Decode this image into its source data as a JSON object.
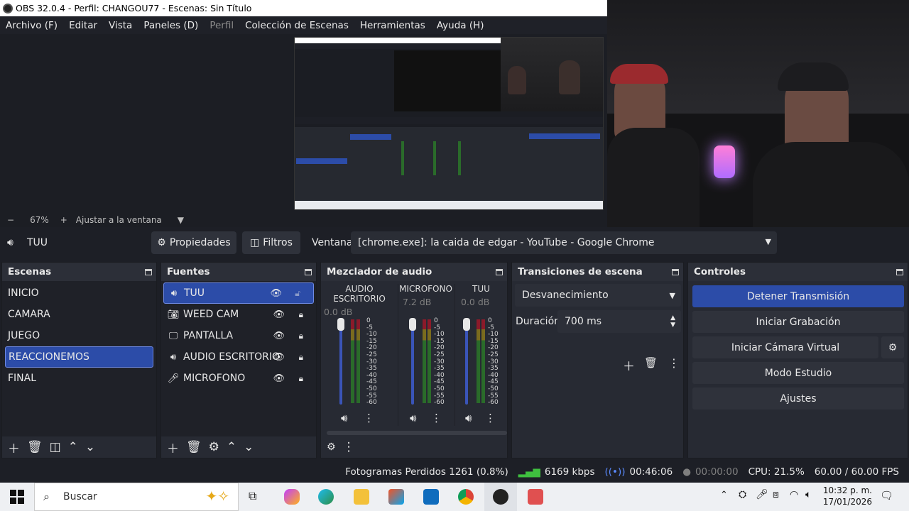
{
  "window": {
    "title": "OBS 32.0.4 - Perfil: CHANGOU77 - Escenas: Sin Título"
  },
  "menu": [
    "Archivo (F)",
    "Editar",
    "Vista",
    "Paneles (D)",
    "Perfil",
    "Colección de Escenas",
    "Herramientas",
    "Ayuda (H)"
  ],
  "zoom": {
    "minus": "−",
    "value": "67%",
    "plus": "+",
    "fit_label": "Ajustar a la ventana"
  },
  "source_toolbar": {
    "source_name": "TUU",
    "properties_label": "Propiedades",
    "filters_label": "Filtros",
    "window_label": "Ventana",
    "window_value": "[chrome.exe]: la caida de edgar - YouTube - Google Chrome"
  },
  "scenes": {
    "title": "Escenas",
    "items": [
      "INICIO",
      "CAMARA",
      "JUEGO",
      "REACCIONEMOS",
      "FINAL"
    ],
    "selected": "REACCIONEMOS"
  },
  "sources": {
    "title": "Fuentes",
    "items": [
      {
        "name": "TUU",
        "icon": "speaker-icon"
      },
      {
        "name": "WEED CAM",
        "icon": "camera-icon"
      },
      {
        "name": "PANTALLA",
        "icon": "monitor-icon"
      },
      {
        "name": "AUDIO ESCRITORIO",
        "icon": "speaker-icon"
      },
      {
        "name": "MICROFONO",
        "icon": "microphone-icon"
      }
    ],
    "selected": "TUU"
  },
  "mixer": {
    "title": "Mezclador de audio",
    "channels": [
      {
        "name": "AUDIO ESCRITORIO",
        "db": "0.0 dB"
      },
      {
        "name": "MICROFONO",
        "db": "7.2 dB"
      },
      {
        "name": "TUU",
        "db": "0.0 dB"
      }
    ],
    "scale": [
      "0",
      "-5",
      "-10",
      "-15",
      "-20",
      "-25",
      "-30",
      "-35",
      "-40",
      "-45",
      "-50",
      "-55",
      "-60"
    ]
  },
  "transitions": {
    "title": "Transiciones de escena",
    "type": "Desvanecimiento",
    "duration_label": "Duración",
    "duration_value": "700 ms"
  },
  "controls": {
    "title": "Controles",
    "stop_stream": "Detener Transmisión",
    "start_recording": "Iniciar Grabación",
    "start_virtual_cam": "Iniciar Cámara Virtual",
    "studio_mode": "Modo Estudio",
    "settings": "Ajustes"
  },
  "status": {
    "dropped_frames": "Fotogramas Perdidos 1261 (0.8%)",
    "bitrate": "6169 kbps",
    "stream_time": "00:46:06",
    "record_time": "00:00:00",
    "cpu": "CPU: 21.5%",
    "fps": "60.00 / 60.00 FPS"
  },
  "taskbar": {
    "search_placeholder": "Buscar",
    "time": "10:32 p. m.",
    "date": "17/01/2026"
  },
  "colors": {
    "accent": "#2c4ca8",
    "panel": "#272a33",
    "bg": "#1d1f26"
  }
}
